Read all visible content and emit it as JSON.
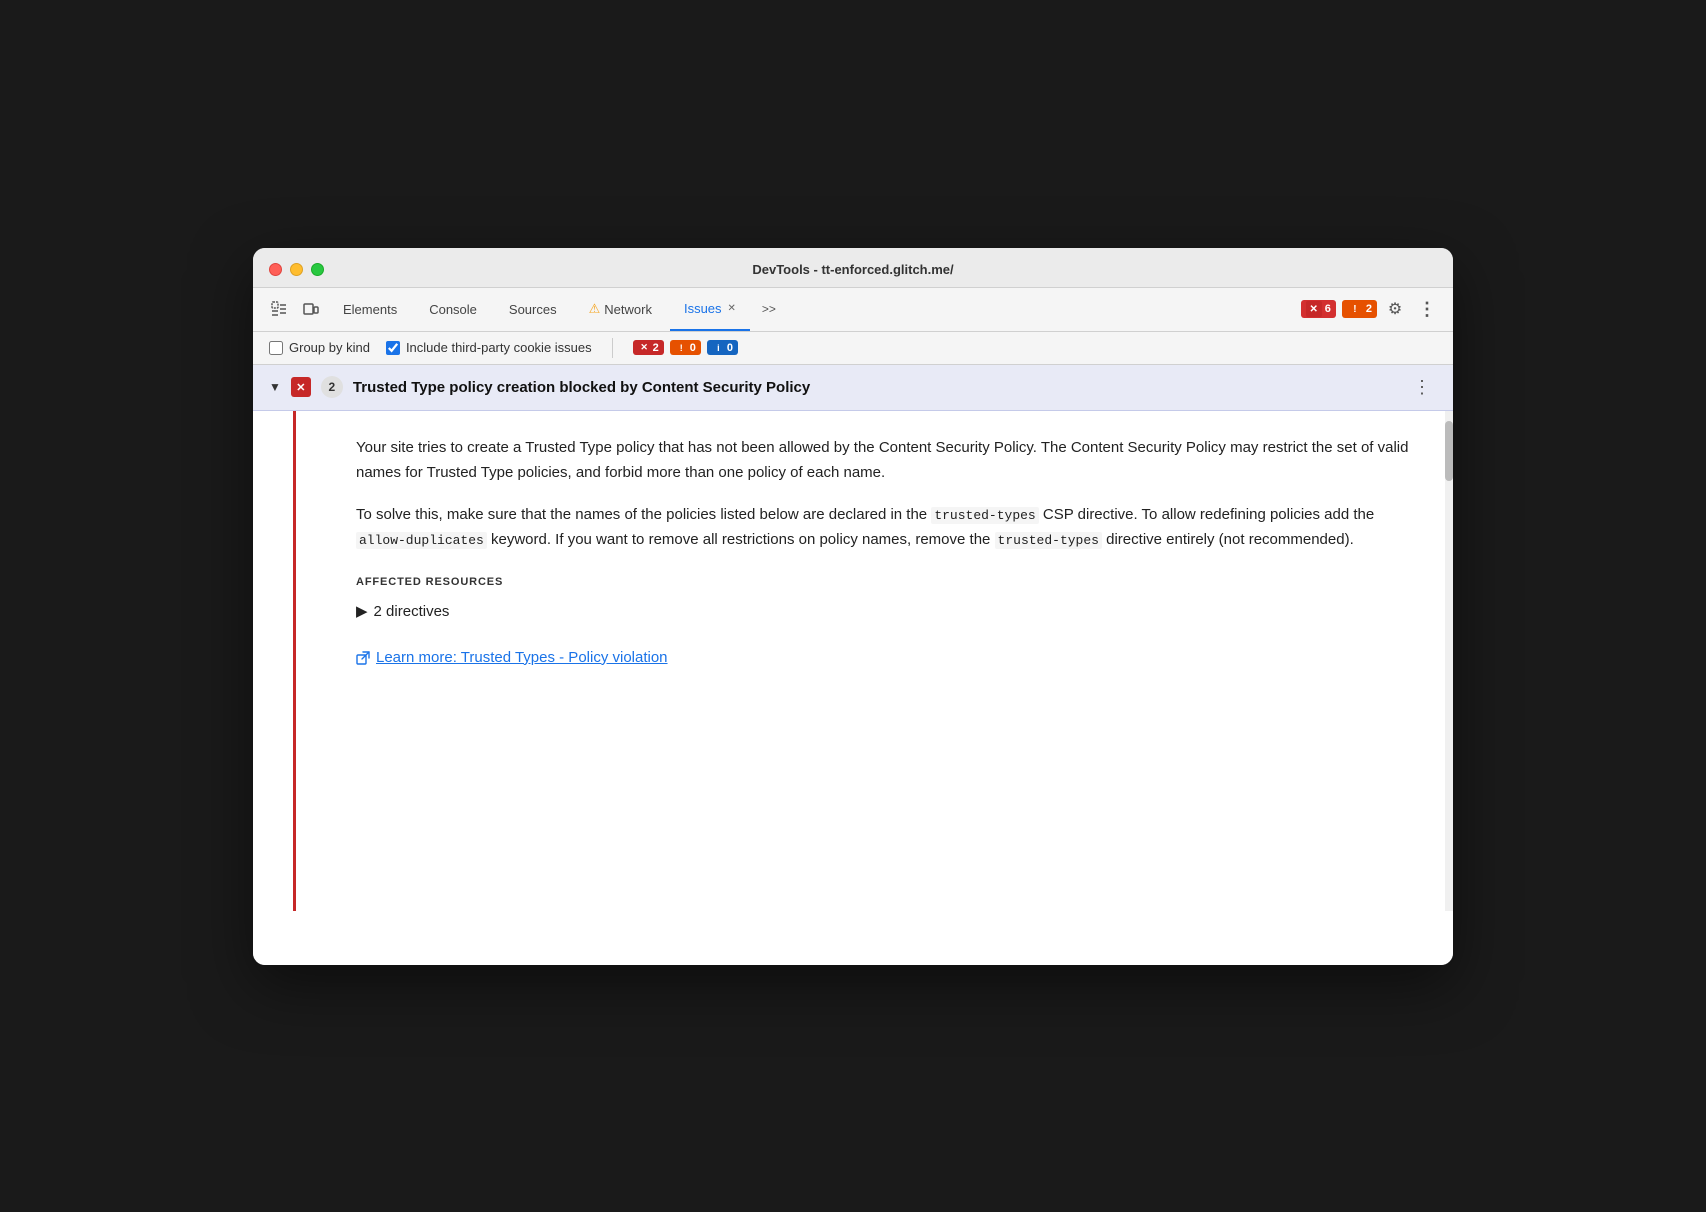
{
  "titlebar": {
    "title": "DevTools - tt-enforced.glitch.me/"
  },
  "toolbar": {
    "tabs": [
      {
        "id": "elements",
        "label": "Elements",
        "active": false,
        "hasWarning": false,
        "hasClose": false
      },
      {
        "id": "console",
        "label": "Console",
        "active": false,
        "hasWarning": false,
        "hasClose": false
      },
      {
        "id": "sources",
        "label": "Sources",
        "active": false,
        "hasWarning": false,
        "hasClose": false
      },
      {
        "id": "network",
        "label": "Network",
        "active": false,
        "hasWarning": true,
        "hasClose": false
      },
      {
        "id": "issues",
        "label": "Issues",
        "active": true,
        "hasWarning": false,
        "hasClose": true
      }
    ],
    "more_button": ">>",
    "badge_red_count": "6",
    "badge_orange_count": "2",
    "settings_label": "⚙",
    "more_menu_label": "⋮"
  },
  "subbar": {
    "group_by_kind_label": "Group by kind",
    "group_by_kind_checked": false,
    "include_third_party_label": "Include third-party cookie issues",
    "include_third_party_checked": true,
    "badge_red_count": "2",
    "badge_orange_count": "0",
    "badge_blue_count": "0"
  },
  "issue": {
    "title": "Trusted Type policy creation blocked by Content Security Policy",
    "count": "2",
    "expanded": true,
    "description_para1": "Your site tries to create a Trusted Type policy that has not been allowed by the Content Security Policy. The Content Security Policy may restrict the set of valid names for Trusted Type policies, and forbid more than one policy of each name.",
    "description_para2_prefix": "To solve this, make sure that the names of the policies listed below are declared in the ",
    "description_para2_code1": "trusted-types",
    "description_para2_mid": " CSP directive. To allow redefining policies add the ",
    "description_para2_code2": "allow-duplicates",
    "description_para2_end": " keyword. If you want to remove all restrictions on policy names, remove the ",
    "description_para2_code3": "trusted-types",
    "description_para2_final": " directive entirely (not recommended).",
    "affected_label": "AFFECTED RESOURCES",
    "directives_text": "2 directives",
    "learn_more_text": "Learn more: Trusted Types - Policy violation",
    "learn_more_url": "#"
  }
}
